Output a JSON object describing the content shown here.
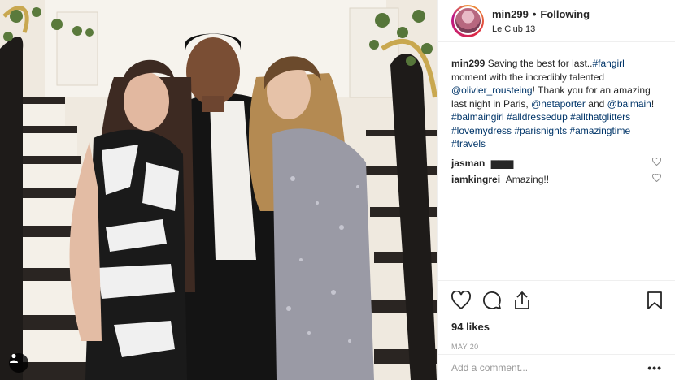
{
  "post": {
    "username": "min299",
    "follow_status": "Following",
    "location": "Le Club 13",
    "caption": {
      "text_1": "Saving the best for last..",
      "tag_fangirl": "#fangirl",
      "text_2": " moment with the incredibly talented ",
      "tag_olivier": "@olivier_rousteing",
      "text_3": "! Thank you for an amazing last night in Paris, ",
      "tag_netaporter": "@netaporter",
      "text_4": " and ",
      "tag_balmain": "@balmain",
      "text_5": "! ",
      "tag_balmaingirl": "#balmaingirl",
      "tag_alldressedup": "#alldressedup",
      "tag_allthatglitters": "#allthatglitters",
      "tag_lovemydress": "#lovemydress",
      "tag_parisnights": "#parisnights",
      "tag_amazingtime": "#amazingtime",
      "tag_travels": "#travels"
    },
    "comments": [
      {
        "user": "jasman",
        "text": "▆▆▆"
      },
      {
        "user": "iamkingrei",
        "text": "Amazing!!"
      }
    ],
    "likes": "94 likes",
    "date": "MAY 20",
    "add_comment_placeholder": "Add a comment...",
    "more_label": "•••"
  },
  "icons": {
    "like": "heart-icon",
    "comment": "comment-icon",
    "share": "share-icon",
    "save": "bookmark-icon",
    "tagged": "person-tag-icon"
  },
  "colors": {
    "link": "#003569",
    "text": "#262626",
    "muted": "#999999"
  }
}
